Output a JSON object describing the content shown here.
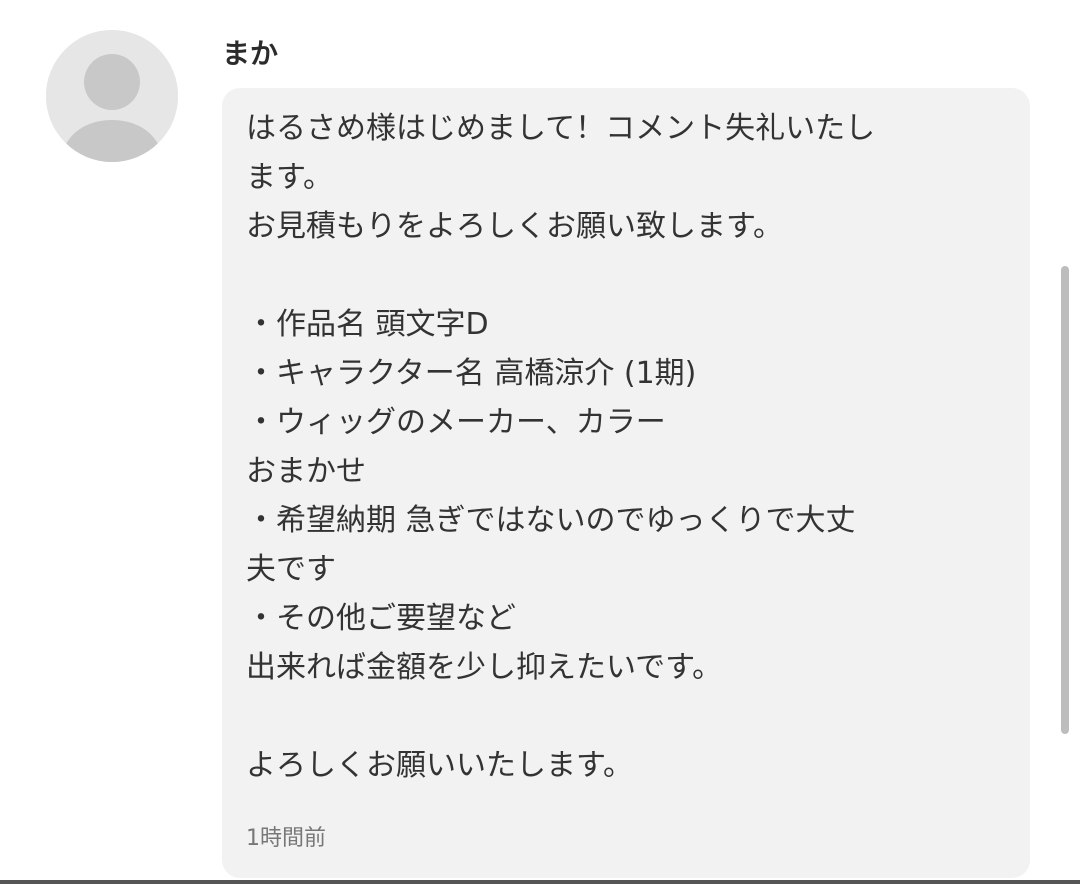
{
  "comment": {
    "author": "まか",
    "avatar_icon": "default-user-avatar-icon",
    "message_lines": [
      "はるさめ様はじめまして！コメント失礼いたし",
      "ます。",
      "お見積もりをよろしくお願い致します。",
      "",
      "・作品名 頭文字D",
      "・キャラクター名 高橋涼介 (1期)",
      "・ウィッグのメーカー、カラー",
      "おまかせ",
      "・希望納期 急ぎではないのでゆっくりで大丈",
      "夫です",
      "・その他ご要望など",
      "出来れば金額を少し抑えたいです。",
      "",
      "よろしくお願いいたします。"
    ],
    "timestamp": "1時間前"
  },
  "colors": {
    "bubble_background": "#f2f2f2",
    "avatar_background": "#e6e6e6",
    "avatar_silhouette": "#c8c8c8",
    "scrollbar": "#bdbdbd"
  }
}
